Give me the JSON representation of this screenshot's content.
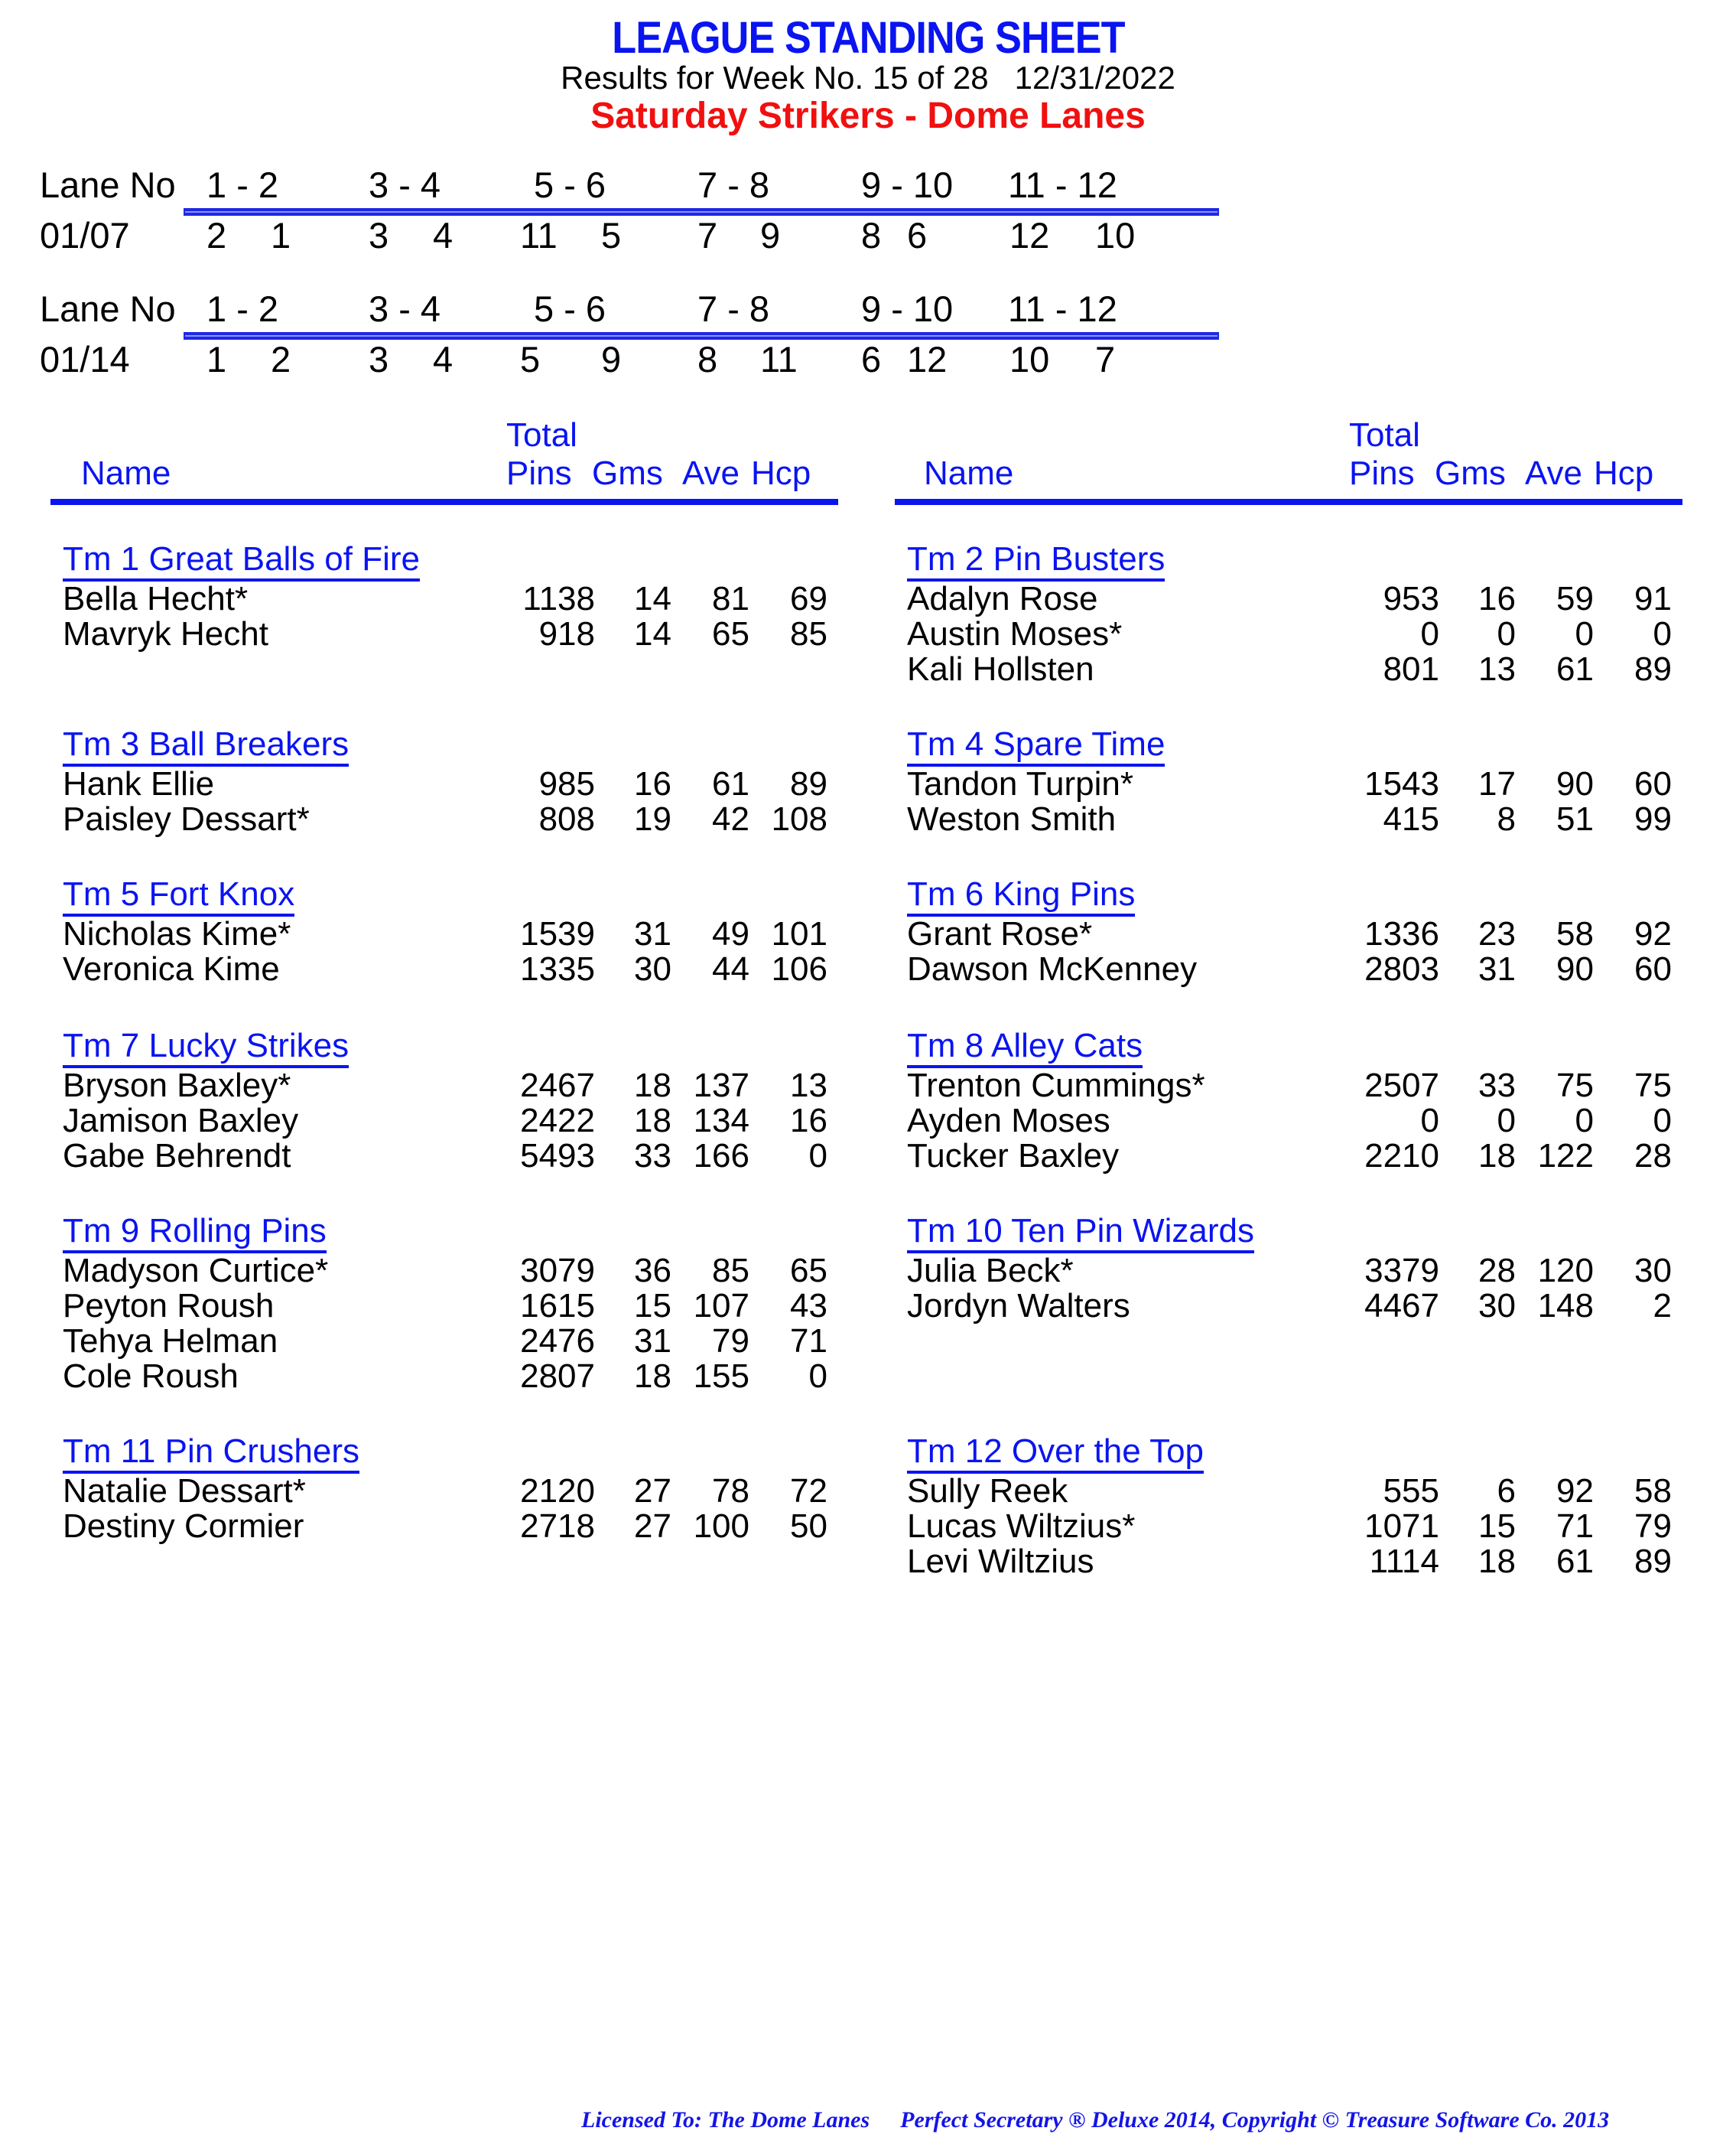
{
  "header": {
    "title": "LEAGUE STANDING SHEET",
    "week_text": "Results for Week No. 15 of 28",
    "date": "12/31/2022",
    "league_name": "Saturday Strikers - Dome Lanes",
    "colors": {
      "title": "#0a14f0",
      "league": "#f01010"
    }
  },
  "lane_assignments": [
    {
      "label": "Lane No",
      "pairs": [
        "1 -  2",
        "3 -  4",
        "5 -  6",
        "7 -  8",
        "9 - 10",
        "11 - 12"
      ],
      "date": "01/07",
      "teams": [
        [
          "2",
          "1"
        ],
        [
          "3",
          "4"
        ],
        [
          "11",
          "5"
        ],
        [
          "7",
          "9"
        ],
        [
          "8",
          "6"
        ],
        [
          "12",
          "10"
        ]
      ]
    },
    {
      "label": "Lane No",
      "pairs": [
        "1 -  2",
        "3 -  4",
        "5 -  6",
        "7 -  8",
        "9 - 10",
        "11 - 12"
      ],
      "date": "01/14",
      "teams": [
        [
          "1",
          "2"
        ],
        [
          "3",
          "4"
        ],
        [
          "5",
          "9"
        ],
        [
          "8",
          "11"
        ],
        [
          "6",
          "12"
        ],
        [
          "10",
          "7"
        ]
      ]
    }
  ],
  "columns": {
    "name": "Name",
    "total": "Total",
    "pins": "Pins",
    "gms": "Gms",
    "ave": "Ave",
    "hcp": "Hcp"
  },
  "teams_left": [
    {
      "name": "Tm 1 Great Balls of Fire",
      "players": [
        {
          "name": "Bella Hecht*",
          "pins": "1138",
          "gms": "14",
          "ave": "81",
          "hcp": "69"
        },
        {
          "name": "Mavryk Hecht",
          "pins": "918",
          "gms": "14",
          "ave": "65",
          "hcp": "85"
        }
      ]
    },
    {
      "name": "Tm 3 Ball Breakers",
      "players": [
        {
          "name": "Hank Ellie",
          "pins": "985",
          "gms": "16",
          "ave": "61",
          "hcp": "89"
        },
        {
          "name": "Paisley Dessart*",
          "pins": "808",
          "gms": "19",
          "ave": "42",
          "hcp": "108"
        }
      ]
    },
    {
      "name": "Tm 5 Fort Knox",
      "players": [
        {
          "name": "Nicholas Kime*",
          "pins": "1539",
          "gms": "31",
          "ave": "49",
          "hcp": "101"
        },
        {
          "name": "Veronica Kime",
          "pins": "1335",
          "gms": "30",
          "ave": "44",
          "hcp": "106"
        }
      ]
    },
    {
      "name": "Tm 7 Lucky Strikes",
      "players": [
        {
          "name": "Bryson Baxley*",
          "pins": "2467",
          "gms": "18",
          "ave": "137",
          "hcp": "13"
        },
        {
          "name": "Jamison Baxley",
          "pins": "2422",
          "gms": "18",
          "ave": "134",
          "hcp": "16"
        },
        {
          "name": "Gabe Behrendt",
          "pins": "5493",
          "gms": "33",
          "ave": "166",
          "hcp": "0"
        }
      ]
    },
    {
      "name": "Tm 9 Rolling Pins",
      "players": [
        {
          "name": "Madyson Curtice*",
          "pins": "3079",
          "gms": "36",
          "ave": "85",
          "hcp": "65"
        },
        {
          "name": "Peyton Roush",
          "pins": "1615",
          "gms": "15",
          "ave": "107",
          "hcp": "43"
        },
        {
          "name": "Tehya Helman",
          "pins": "2476",
          "gms": "31",
          "ave": "79",
          "hcp": "71"
        },
        {
          "name": "Cole Roush",
          "pins": "2807",
          "gms": "18",
          "ave": "155",
          "hcp": "0"
        }
      ]
    },
    {
      "name": "Tm 11 Pin Crushers",
      "players": [
        {
          "name": "Natalie Dessart*",
          "pins": "2120",
          "gms": "27",
          "ave": "78",
          "hcp": "72"
        },
        {
          "name": "Destiny Cormier",
          "pins": "2718",
          "gms": "27",
          "ave": "100",
          "hcp": "50"
        }
      ]
    }
  ],
  "teams_right": [
    {
      "name": "Tm 2 Pin Busters",
      "players": [
        {
          "name": "Adalyn Rose",
          "pins": "953",
          "gms": "16",
          "ave": "59",
          "hcp": "91"
        },
        {
          "name": "Austin Moses*",
          "pins": "0",
          "gms": "0",
          "ave": "0",
          "hcp": "0"
        },
        {
          "name": "Kali Hollsten",
          "pins": "801",
          "gms": "13",
          "ave": "61",
          "hcp": "89"
        }
      ]
    },
    {
      "name": "Tm 4 Spare Time",
      "players": [
        {
          "name": "Tandon Turpin*",
          "pins": "1543",
          "gms": "17",
          "ave": "90",
          "hcp": "60"
        },
        {
          "name": "Weston Smith",
          "pins": "415",
          "gms": "8",
          "ave": "51",
          "hcp": "99"
        }
      ]
    },
    {
      "name": "Tm 6 King Pins",
      "players": [
        {
          "name": "Grant Rose*",
          "pins": "1336",
          "gms": "23",
          "ave": "58",
          "hcp": "92"
        },
        {
          "name": "Dawson McKenney",
          "pins": "2803",
          "gms": "31",
          "ave": "90",
          "hcp": "60"
        }
      ]
    },
    {
      "name": "Tm 8 Alley Cats",
      "players": [
        {
          "name": "Trenton Cummings*",
          "pins": "2507",
          "gms": "33",
          "ave": "75",
          "hcp": "75"
        },
        {
          "name": "Ayden Moses",
          "pins": "0",
          "gms": "0",
          "ave": "0",
          "hcp": "0"
        },
        {
          "name": "Tucker Baxley",
          "pins": "2210",
          "gms": "18",
          "ave": "122",
          "hcp": "28"
        }
      ]
    },
    {
      "name": "Tm 10 Ten Pin Wizards",
      "players": [
        {
          "name": "Julia Beck*",
          "pins": "3379",
          "gms": "28",
          "ave": "120",
          "hcp": "30"
        },
        {
          "name": "Jordyn Walters",
          "pins": "4467",
          "gms": "30",
          "ave": "148",
          "hcp": "2"
        }
      ]
    },
    {
      "name": "Tm 12 Over the Top",
      "players": [
        {
          "name": "Sully Reek",
          "pins": "555",
          "gms": "6",
          "ave": "92",
          "hcp": "58"
        },
        {
          "name": "Lucas Wiltzius*",
          "pins": "1071",
          "gms": "15",
          "ave": "71",
          "hcp": "79"
        },
        {
          "name": "Levi Wiltzius",
          "pins": "1114",
          "gms": "18",
          "ave": "61",
          "hcp": "89"
        }
      ]
    }
  ],
  "footer": {
    "licensed": "Licensed To: The Dome Lanes",
    "software": "Perfect Secretary ® Deluxe  2014, Copyright © Treasure Software Co. 2013"
  }
}
